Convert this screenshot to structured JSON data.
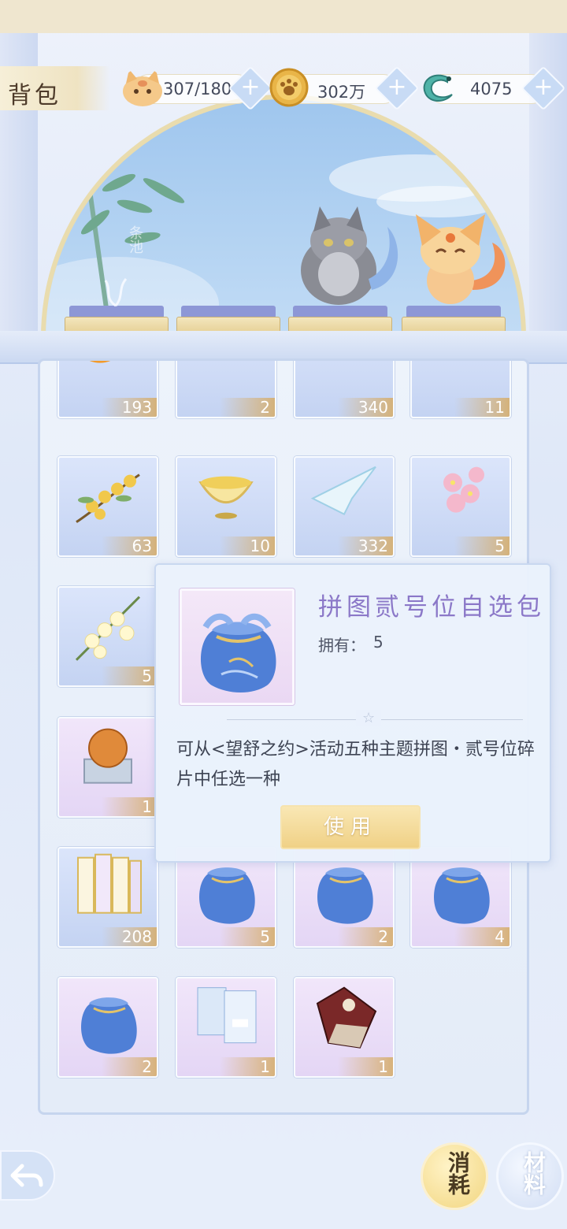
{
  "header": {
    "title": "背包",
    "resources": [
      {
        "icon": "cat-face-icon",
        "value": "307/180"
      },
      {
        "icon": "paw-coin-icon",
        "value": "302万"
      },
      {
        "icon": "jade-dragon-icon",
        "value": "4075"
      }
    ],
    "plus_symbol": "+"
  },
  "scene": {
    "banner_text": "条池"
  },
  "items": [
    {
      "icon": "orange-orb-icon",
      "count": "193",
      "bg": "blue"
    },
    {
      "icon": "ribbon-icon",
      "count": "2",
      "bg": "blue"
    },
    {
      "icon": "crystal-shoe-icon",
      "count": "340",
      "bg": "blue"
    },
    {
      "icon": "scroll-icon",
      "count": "11",
      "bg": "blue"
    },
    {
      "icon": "osmanthus-branch-icon",
      "count": "63",
      "bg": "blue"
    },
    {
      "icon": "tea-bowl-icon",
      "count": "10",
      "bg": "blue"
    },
    {
      "icon": "paper-crane-icon",
      "count": "332",
      "bg": "blue"
    },
    {
      "icon": "peach-blossom-icon",
      "count": "5",
      "bg": "blue"
    },
    {
      "icon": "white-blossom-icon",
      "count": "5",
      "bg": "blue"
    },
    {
      "icon": "amber-orb-chest-icon",
      "count": "1",
      "bg": "pink"
    },
    {
      "icon": "scroll-bundle-icon",
      "count": "208",
      "bg": "blue"
    },
    {
      "icon": "blue-pouch-icon",
      "count": "5",
      "bg": "pink"
    },
    {
      "icon": "blue-pouch-icon",
      "count": "2",
      "bg": "pink"
    },
    {
      "icon": "blue-pouch-icon",
      "count": "4",
      "bg": "pink"
    },
    {
      "icon": "blue-pouch-icon",
      "count": "2",
      "bg": "pink"
    },
    {
      "icon": "envelope-book-icon",
      "count": "1",
      "bg": "pink"
    },
    {
      "icon": "puzzle-piece-icon",
      "count": "1",
      "bg": "pink"
    }
  ],
  "popup": {
    "title": "拼图贰号位自选包",
    "owned_label": "拥有：",
    "owned_value": "5",
    "divider_symbol": "☆",
    "description": "可从<望舒之约>活动五种主题拼图・贰号位碎片中任选一种",
    "use_button": "使用"
  },
  "bottom": {
    "back_icon": "back-arrow-icon",
    "tab_consume": "消耗",
    "tab_material": "材料"
  },
  "colors": {
    "accent_gold": "#f0d186",
    "title_purple": "#8b78c8"
  }
}
